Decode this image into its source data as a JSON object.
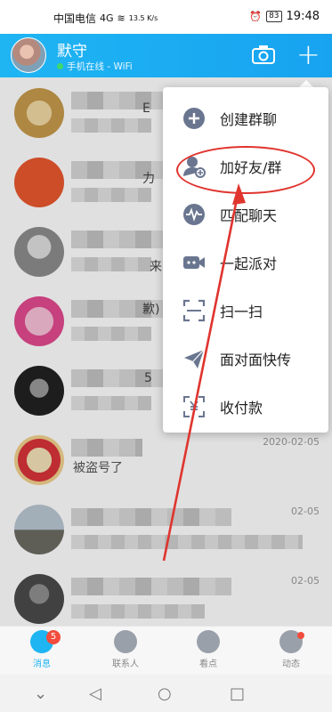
{
  "status_bar": {
    "carrier": "中国电信",
    "network": "4G",
    "speed": "13.5 K/s",
    "battery": "83",
    "time": "19:48"
  },
  "header": {
    "name": "默守",
    "status": "手机在线 - WiFi",
    "plus": "+"
  },
  "chats": [
    {
      "snippet": "E",
      "time": ""
    },
    {
      "snippet": "力",
      "time": ""
    },
    {
      "snippet": "来",
      "time": ""
    },
    {
      "snippet": "歉)",
      "time": ""
    },
    {
      "snippet": "5",
      "time": ""
    },
    {
      "snippet": "被盗号了",
      "time": "2020-02-05"
    },
    {
      "snippet": "",
      "time": "02-05"
    },
    {
      "snippet": "",
      "time": "02-05"
    }
  ],
  "menu": {
    "items": [
      {
        "label": "创建群聊",
        "icon": "plus-circle-icon"
      },
      {
        "label": "加好友/群",
        "icon": "add-friend-icon"
      },
      {
        "label": "匹配聊天",
        "icon": "wave-icon"
      },
      {
        "label": "一起派对",
        "icon": "party-icon"
      },
      {
        "label": "扫一扫",
        "icon": "scan-icon"
      },
      {
        "label": "面对面快传",
        "icon": "send-icon"
      },
      {
        "label": "收付款",
        "icon": "payment-icon"
      }
    ]
  },
  "tabs": [
    {
      "label": "消息",
      "badge": "5"
    },
    {
      "label": "联系人"
    },
    {
      "label": "看点"
    },
    {
      "label": "动态"
    }
  ],
  "colors": {
    "accent": "#1fb5f3",
    "highlight": "#e0342e",
    "badge": "#f24c3d"
  }
}
